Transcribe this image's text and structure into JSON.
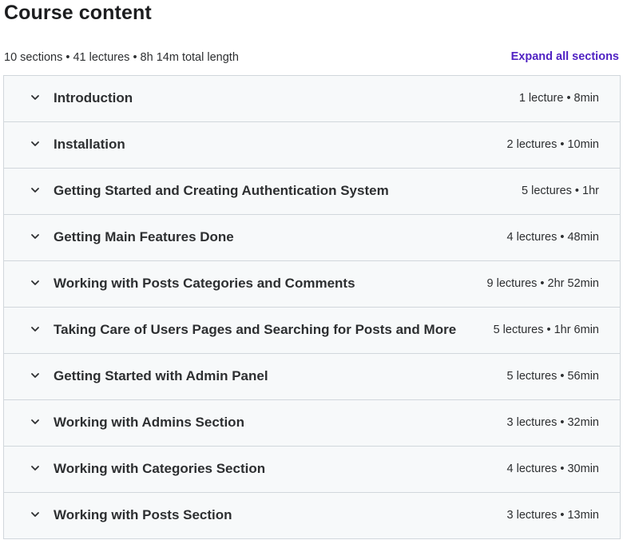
{
  "header": {
    "title": "Course content",
    "summary": "10 sections • 41 lectures • 8h 14m total length",
    "expand_label": "Expand all sections"
  },
  "colors": {
    "accent": "#5022c3",
    "section_bg": "#f7f9fa",
    "border": "#d1d7dc",
    "text": "#2d2f31"
  },
  "sections": [
    {
      "title": "Introduction",
      "meta": "1 lecture • 8min",
      "icon": "chevron-down-icon"
    },
    {
      "title": "Installation",
      "meta": "2 lectures • 10min",
      "icon": "chevron-down-icon"
    },
    {
      "title": "Getting Started and Creating Authentication System",
      "meta": "5 lectures • 1hr",
      "icon": "chevron-down-icon"
    },
    {
      "title": "Getting Main Features Done",
      "meta": "4 lectures • 48min",
      "icon": "chevron-down-icon"
    },
    {
      "title": "Working with Posts Categories and Comments",
      "meta": "9 lectures • 2hr 52min",
      "icon": "chevron-down-icon"
    },
    {
      "title": "Taking Care of Users Pages and Searching for Posts and More",
      "meta": "5 lectures • 1hr 6min",
      "icon": "chevron-down-icon"
    },
    {
      "title": "Getting Started with Admin Panel",
      "meta": "5 lectures • 56min",
      "icon": "chevron-down-icon"
    },
    {
      "title": "Working with Admins Section",
      "meta": "3 lectures • 32min",
      "icon": "chevron-down-icon"
    },
    {
      "title": "Working with Categories Section",
      "meta": "4 lectures • 30min",
      "icon": "chevron-down-icon"
    },
    {
      "title": "Working with Posts Section",
      "meta": "3 lectures • 13min",
      "icon": "chevron-down-icon"
    }
  ]
}
